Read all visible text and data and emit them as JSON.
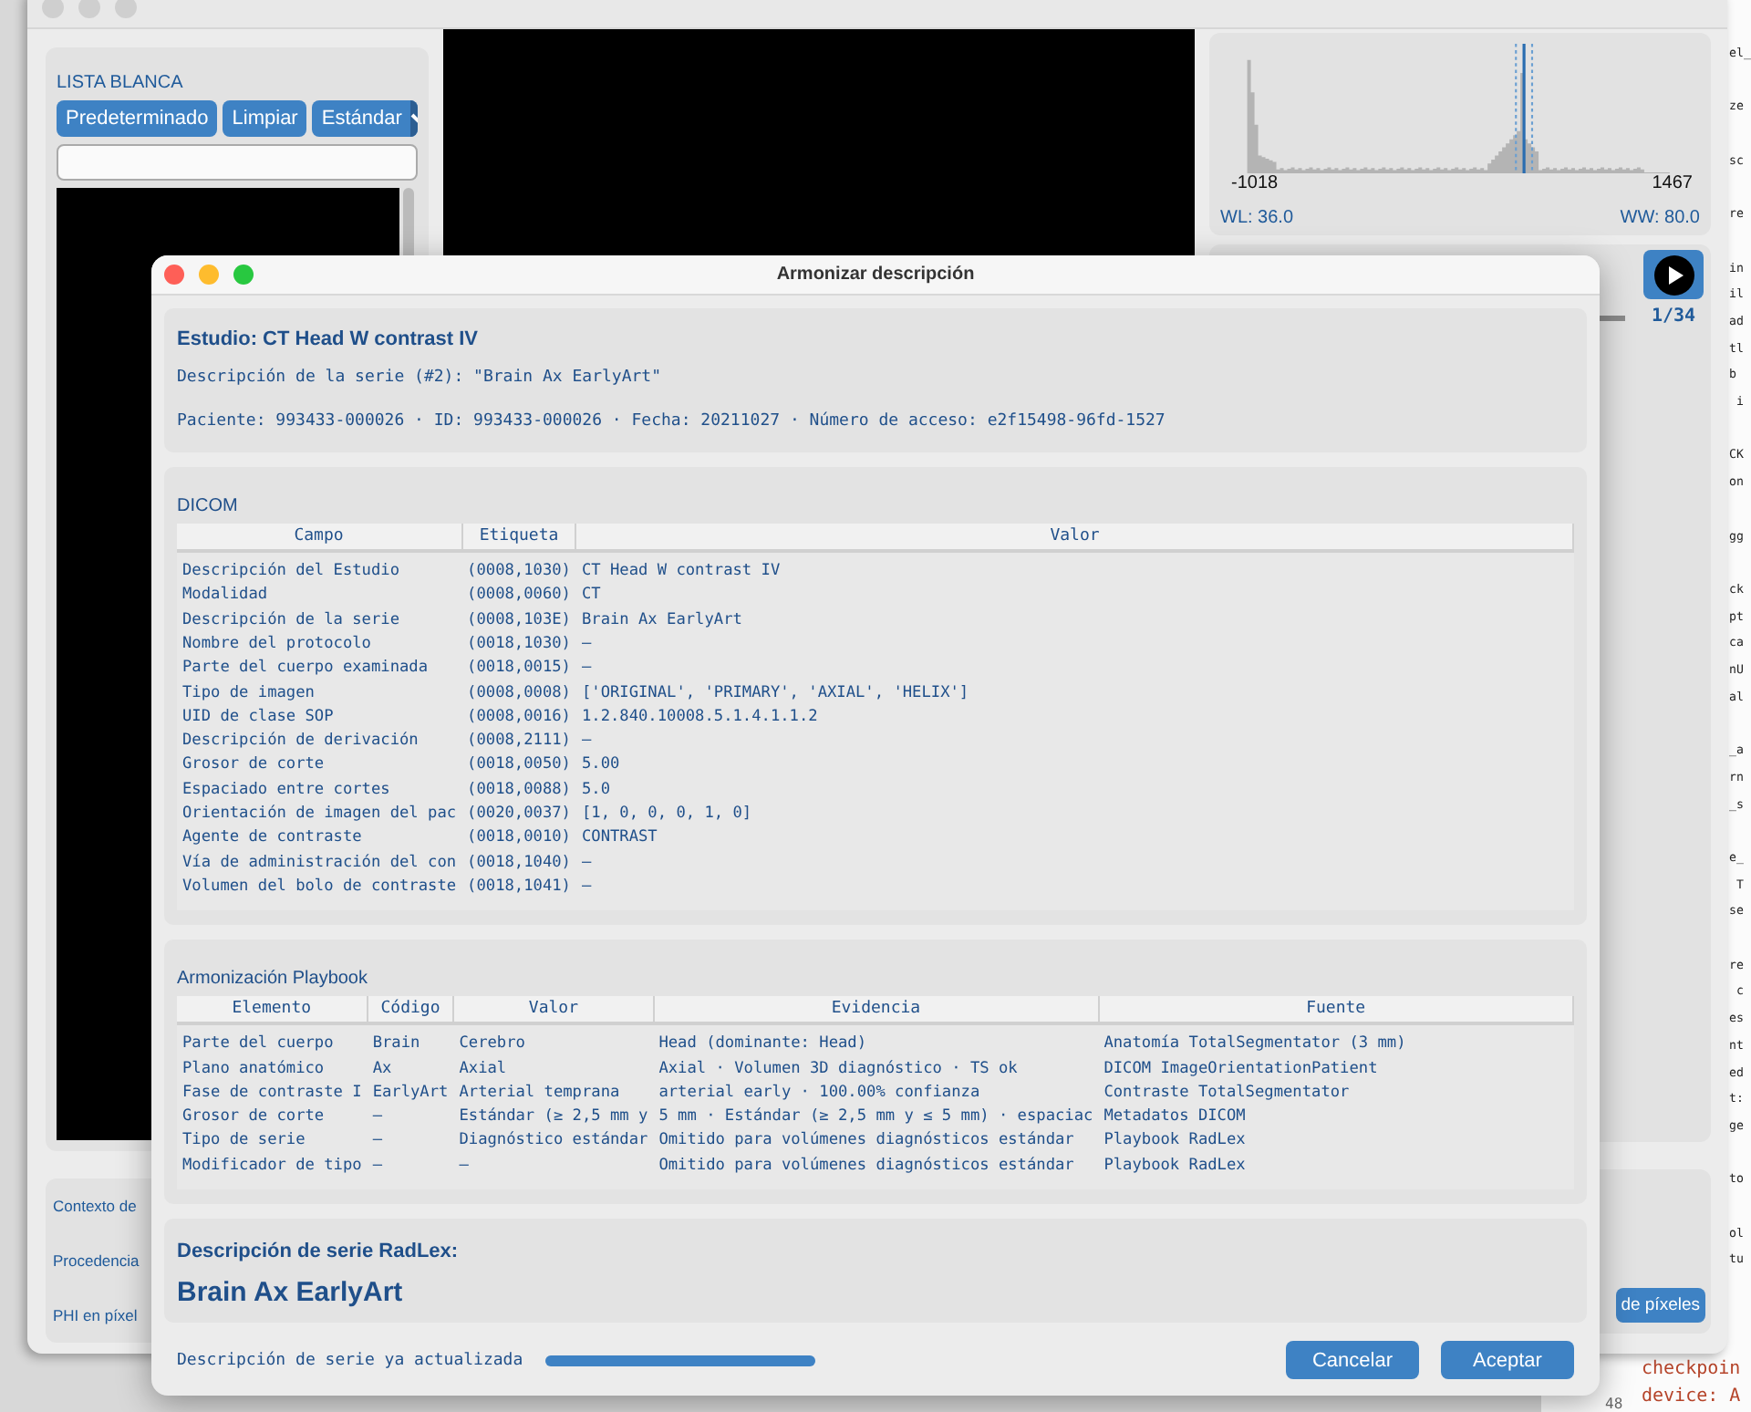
{
  "background_window": {
    "whitelist": {
      "title": "LISTA BLANCA",
      "buttons": [
        "Predeterminado",
        "Limpiar"
      ],
      "dropdown": "Estándar"
    },
    "histogram": {
      "min": "-1018",
      "max": "1467",
      "wl": "WL: 36.0",
      "ww": "WW: 80.0"
    },
    "player": {
      "frame": "1/34"
    },
    "context_labels": [
      "Contexto de",
      "Procedencia",
      "PHI en píxel"
    ],
    "pixel_button": "de píxeles"
  },
  "code_editor": {
    "blocks": [
      [
        "el_"
      ],
      [
        "ze"
      ],
      [
        "sc"
      ],
      [
        "re"
      ],
      [
        "in",
        "il",
        "ad",
        "tl",
        "b",
        " i"
      ],
      [
        "CK",
        "on"
      ],
      [
        "gg"
      ],
      [
        "ck",
        "pt",
        "ca",
        "nU",
        "al"
      ],
      [
        "_a",
        "rn",
        "_s"
      ],
      [
        "e_",
        " T",
        "se"
      ],
      [
        "re",
        " c",
        "es",
        "nt",
        "ed",
        "t:",
        "ge"
      ],
      [
        "to"
      ],
      [
        "ol",
        "tu"
      ]
    ],
    "bottom_lines": [
      "checkpoin",
      "device: A"
    ],
    "line_number": "48"
  },
  "dialog": {
    "title": "Armonizar descripción",
    "study": {
      "title": "Estudio: CT Head W contrast IV",
      "series": "Descripción de la serie (#2): \"Brain Ax EarlyArt\"",
      "patient": "Paciente: 993433-000026 · ID: 993433-000026 · Fecha: 20211027 · Número de acceso: e2f15498-96fd-1527"
    },
    "dicom": {
      "title": "DICOM",
      "columns": [
        "Campo",
        "Etiqueta",
        "Valor"
      ],
      "rows": [
        [
          "Descripción del Estudio",
          "(0008,1030)",
          "CT Head W contrast IV"
        ],
        [
          "Modalidad",
          "(0008,0060)",
          "CT"
        ],
        [
          "Descripción de la serie",
          "(0008,103E)",
          "Brain Ax EarlyArt"
        ],
        [
          "Nombre del protocolo",
          "(0018,1030)",
          "—"
        ],
        [
          "Parte del cuerpo examinada",
          "(0018,0015)",
          "—"
        ],
        [
          "Tipo de imagen",
          "(0008,0008)",
          "['ORIGINAL', 'PRIMARY', 'AXIAL', 'HELIX']"
        ],
        [
          "UID de clase SOP",
          "(0008,0016)",
          "1.2.840.10008.5.1.4.1.1.2"
        ],
        [
          "Descripción de derivación",
          "(0008,2111)",
          "—"
        ],
        [
          "Grosor de corte",
          "(0018,0050)",
          "5.00"
        ],
        [
          "Espaciado entre cortes",
          "(0018,0088)",
          "5.0"
        ],
        [
          "Orientación de imagen del pac",
          "(0020,0037)",
          "[1, 0, 0, 0, 1, 0]"
        ],
        [
          "Agente de contraste",
          "(0018,0010)",
          "CONTRAST"
        ],
        [
          "Vía de administración del con",
          "(0018,1040)",
          "—"
        ],
        [
          "Volumen del bolo de contraste",
          "(0018,1041)",
          "—"
        ]
      ]
    },
    "playbook": {
      "title": "Armonización Playbook",
      "columns": [
        "Elemento",
        "Código",
        "Valor",
        "Evidencia",
        "Fuente"
      ],
      "rows": [
        [
          "Parte del cuerpo",
          "Brain",
          "Cerebro",
          "Head (dominante: Head)",
          "Anatomía TotalSegmentator (3 mm)"
        ],
        [
          "Plano anatómico",
          "Ax",
          "Axial",
          "Axial · Volumen 3D diagnóstico · TS ok",
          "DICOM ImageOrientationPatient"
        ],
        [
          "Fase de contraste I",
          "EarlyArt",
          "Arterial temprana",
          "arterial early · 100.00% confianza",
          "Contraste TotalSegmentator"
        ],
        [
          "Grosor de corte",
          "—",
          "Estándar (≥ 2,5 mm y",
          "5 mm · Estándar (≥ 2,5 mm y ≤ 5 mm) · espaciac",
          "Metadatos DICOM"
        ],
        [
          "Tipo de serie",
          "—",
          "Diagnóstico estándar",
          "Omitido para volúmenes diagnósticos estándar",
          "Playbook RadLex"
        ],
        [
          "Modificador de tipo",
          "—",
          "—",
          "Omitido para volúmenes diagnósticos estándar",
          "Playbook RadLex"
        ]
      ]
    },
    "radlex": {
      "label": "Descripción de serie RadLex:",
      "value": "Brain Ax EarlyArt"
    },
    "footer": {
      "status": "Descripción de serie ya actualizada",
      "progress": {
        "level": 1.0
      },
      "buttons": [
        "Cancelar",
        "Aceptar"
      ]
    }
  }
}
